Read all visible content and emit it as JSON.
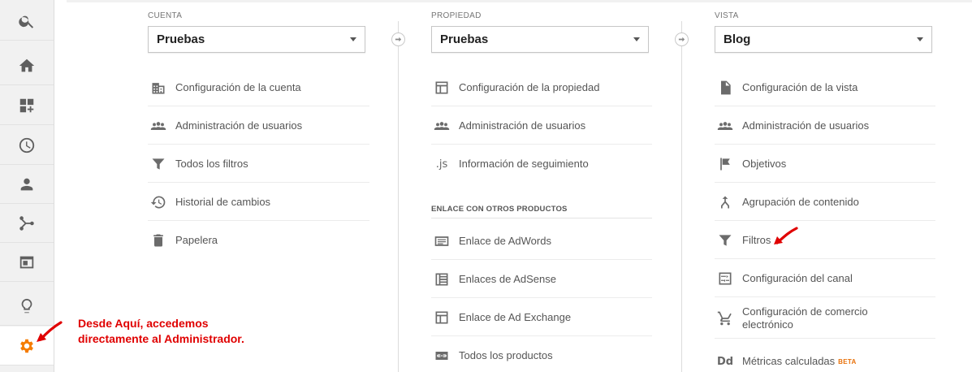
{
  "colors": {
    "admin_accent": "#f57c00",
    "annotation": "#e00000"
  },
  "rail": {
    "items": [
      {
        "icon": "search-icon"
      },
      {
        "icon": "home-icon"
      },
      {
        "icon": "dashboard-add-icon"
      },
      {
        "icon": "clock-icon"
      },
      {
        "icon": "person-icon"
      },
      {
        "icon": "acquisition-icon"
      },
      {
        "icon": "behavior-icon"
      },
      {
        "icon": "lightbulb-icon"
      },
      {
        "icon": "gear-icon"
      }
    ]
  },
  "account": {
    "label": "CUENTA",
    "selected": "Pruebas",
    "items": [
      {
        "label": "Configuración de la cuenta",
        "icon": "building-icon"
      },
      {
        "label": "Administración de usuarios",
        "icon": "users-icon"
      },
      {
        "label": "Todos los filtros",
        "icon": "filter-icon"
      },
      {
        "label": "Historial de cambios",
        "icon": "history-icon"
      },
      {
        "label": "Papelera",
        "icon": "trash-icon"
      }
    ]
  },
  "property": {
    "label": "PROPIEDAD",
    "selected": "Pruebas",
    "items": [
      {
        "label": "Configuración de la propiedad",
        "icon": "window-icon"
      },
      {
        "label": "Administración de usuarios",
        "icon": "users-icon"
      },
      {
        "label": "Información de seguimiento",
        "icon": "js-icon",
        "glyph": ".js"
      }
    ],
    "section_head": "ENLACE CON OTROS PRODUCTOS",
    "links": [
      {
        "label": "Enlace de AdWords",
        "icon": "adwords-icon"
      },
      {
        "label": "Enlaces de AdSense",
        "icon": "adsense-icon"
      },
      {
        "label": "Enlace de Ad Exchange",
        "icon": "adexchange-icon"
      },
      {
        "label": "Todos los productos",
        "icon": "link-icon"
      }
    ]
  },
  "view": {
    "label": "VISTA",
    "selected": "Blog",
    "items": [
      {
        "label": "Configuración de la vista",
        "icon": "document-icon"
      },
      {
        "label": "Administración de usuarios",
        "icon": "users-icon"
      },
      {
        "label": "Objetivos",
        "icon": "flag-icon"
      },
      {
        "label": "Agrupación de contenido",
        "icon": "grouping-icon"
      },
      {
        "label": "Filtros",
        "icon": "filter-icon"
      },
      {
        "label": "Configuración del canal",
        "icon": "channel-icon"
      },
      {
        "label": "Configuración de comercio electrónico",
        "icon": "cart-icon"
      },
      {
        "label": "Métricas calculadas",
        "icon": "dd-icon",
        "glyph": "Dd",
        "badge": "BETA"
      }
    ]
  },
  "annotation": {
    "line1": "Desde Aquí, accedemos",
    "line2": "directamente al Administrador."
  }
}
